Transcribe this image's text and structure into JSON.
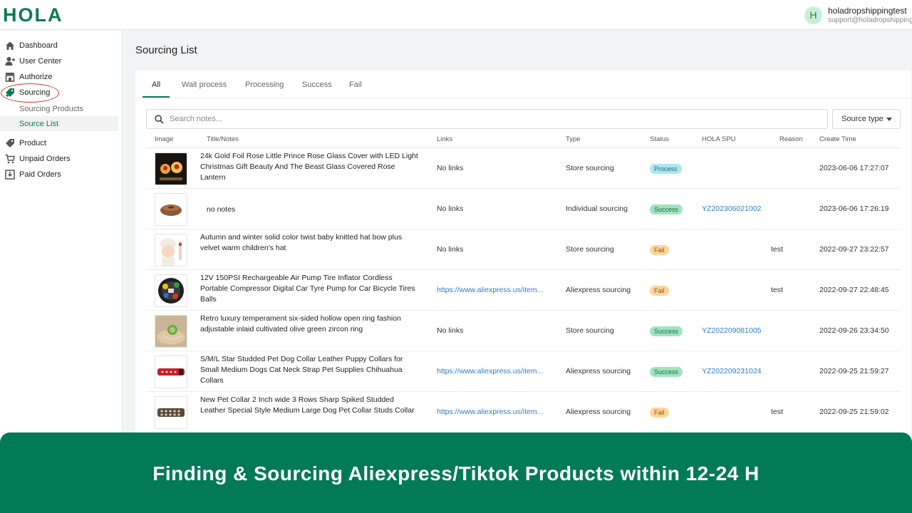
{
  "header": {
    "logo": "HOLA",
    "user_initial": "H",
    "user_name": "holadropshippingtest",
    "user_email": "support@holadropshipping..."
  },
  "sidebar": {
    "items": [
      {
        "label": "Dashboard",
        "icon": "home-icon"
      },
      {
        "label": "User Center",
        "icon": "user-icon"
      },
      {
        "label": "Authorize",
        "icon": "store-icon"
      },
      {
        "label": "Sourcing",
        "icon": "sourcing-icon"
      },
      {
        "label": "Product",
        "icon": "tag-icon"
      },
      {
        "label": "Unpaid Orders",
        "icon": "cart-icon"
      },
      {
        "label": "Paid Orders",
        "icon": "download-icon"
      }
    ],
    "sub_items": [
      {
        "label": "Sourcing Products",
        "active": false
      },
      {
        "label": "Source List",
        "active": true
      }
    ]
  },
  "page": {
    "title": "Sourcing List",
    "tabs": [
      "All",
      "Wait process",
      "Processing",
      "Success",
      "Fail"
    ],
    "active_tab": "All",
    "search_placeholder": "Search notes...",
    "filter_label": "Source type"
  },
  "table": {
    "columns": [
      "Image",
      "Title/Notes",
      "Links",
      "Type",
      "Status",
      "HOLA SPU",
      "Reason",
      "Create Time"
    ],
    "rows": [
      {
        "title": "24k Gold Foil Rose Little Prince Rose Glass Cover with LED Light Christmas Gift Beauty And The Beast Glass Covered Rose Lantern",
        "link": "No links",
        "type": "Store sourcing",
        "status": "Process",
        "spu": "",
        "reason": "",
        "time": "2023-06-06 17:27:07"
      },
      {
        "title": "no notes",
        "link": "No links",
        "type": "Individual sourcing",
        "status": "Success",
        "spu": "YZ202306021002",
        "reason": "",
        "time": "2023-06-06 17:26:19"
      },
      {
        "title": "Autumn and winter solid color twist baby knitted hat bow plus velvet warm children's hat",
        "link": "No links",
        "type": "Store sourcing",
        "status": "Fail",
        "spu": "",
        "reason": "test",
        "time": "2022-09-27 23:22:57"
      },
      {
        "title": "12V 150PSI Rechargeable Air Pump Tire Inflator Cordless Portable Compressor Digital Car Tyre Pump for Car Bicycle Tires Balls",
        "link": "https://www.aliexpress.us/item...",
        "type": "Aliexpress sourcing",
        "status": "Fail",
        "spu": "",
        "reason": "test",
        "time": "2022-09-27 22:48:45"
      },
      {
        "title": "Retro luxury temperament six-sided hollow open ring fashion adjustable inlaid cultivated olive green zircon ring",
        "link": "No links",
        "type": "Store sourcing",
        "status": "Success",
        "spu": "YZ202209081005",
        "reason": "",
        "time": "2022-09-26 23:34:50"
      },
      {
        "title": "S/M/L Star Studded Pet Dog Collar Leather Puppy Collars for Small Medium Dogs Cat Neck Strap Pet Supplies Chihuahua Collars",
        "link": "https://www.aliexpress.us/item...",
        "type": "Aliexpress sourcing",
        "status": "Success",
        "spu": "YZ202209231024",
        "reason": "",
        "time": "2022-09-25 21:59:27"
      },
      {
        "title": "New Pet Collar 2 Inch wide 3 Rows Sharp Spiked Studded Leather Special Style Medium Large Dog Pet Collar Studs Collar",
        "link": "https://www.aliexpress.us/item...",
        "type": "Aliexpress sourcing",
        "status": "Fail",
        "spu": "",
        "reason": "test",
        "time": "2022-09-25 21:59:02"
      }
    ]
  },
  "banner": {
    "text": "Finding & Sourcing Aliexpress/Tiktok Products within 12-24 H"
  },
  "colors": {
    "brand": "#0b7a55",
    "banner": "#037a56",
    "link": "#2f7ec7",
    "process": "#aee6f0",
    "success": "#9fe3bf",
    "fail": "#ffd49a",
    "highlight_ring": "#d9342b"
  }
}
